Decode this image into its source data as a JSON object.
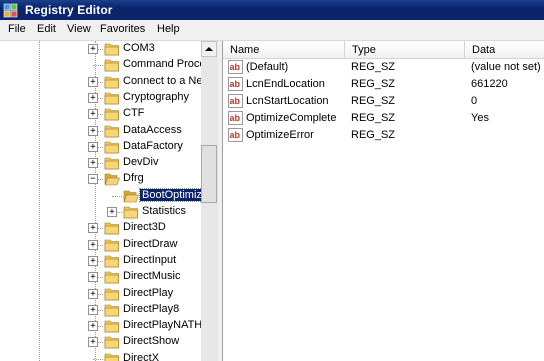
{
  "window": {
    "title": "Registry Editor"
  },
  "menu": [
    "File",
    "Edit",
    "View",
    "Favorites",
    "Help"
  ],
  "tree": {
    "items": [
      {
        "label": "COM3",
        "expander": "+",
        "level": 0
      },
      {
        "label": "Command Proce",
        "expander": "",
        "level": 0
      },
      {
        "label": "Connect to a Ne",
        "expander": "+",
        "level": 0
      },
      {
        "label": "Cryptography",
        "expander": "+",
        "level": 0
      },
      {
        "label": "CTF",
        "expander": "+",
        "level": 0
      },
      {
        "label": "DataAccess",
        "expander": "+",
        "level": 0
      },
      {
        "label": "DataFactory",
        "expander": "+",
        "level": 0
      },
      {
        "label": "DevDiv",
        "expander": "+",
        "level": 0
      },
      {
        "label": "Dfrg",
        "expander": "−",
        "level": 0
      },
      {
        "label": "BootOptimiz",
        "expander": "",
        "level": 1,
        "selected": true
      },
      {
        "label": "Statistics",
        "expander": "+",
        "level": 1
      },
      {
        "label": "Direct3D",
        "expander": "+",
        "level": 0
      },
      {
        "label": "DirectDraw",
        "expander": "+",
        "level": 0
      },
      {
        "label": "DirectInput",
        "expander": "+",
        "level": 0
      },
      {
        "label": "DirectMusic",
        "expander": "+",
        "level": 0
      },
      {
        "label": "DirectPlay",
        "expander": "+",
        "level": 0
      },
      {
        "label": "DirectPlay8",
        "expander": "+",
        "level": 0
      },
      {
        "label": "DirectPlayNATHe",
        "expander": "+",
        "level": 0
      },
      {
        "label": "DirectShow",
        "expander": "+",
        "level": 0
      },
      {
        "label": "DirectX",
        "expander": "",
        "level": 0
      }
    ]
  },
  "list": {
    "columns": [
      "Name",
      "Type",
      "Data"
    ],
    "rows": [
      {
        "name": "(Default)",
        "type": "REG_SZ",
        "data": "(value not set)"
      },
      {
        "name": "LcnEndLocation",
        "type": "REG_SZ",
        "data": "661220"
      },
      {
        "name": "LcnStartLocation",
        "type": "REG_SZ",
        "data": "0"
      },
      {
        "name": "OptimizeComplete",
        "type": "REG_SZ",
        "data": "Yes"
      },
      {
        "name": "OptimizeError",
        "type": "REG_SZ",
        "data": ""
      }
    ],
    "value_icon_text": "ab"
  },
  "colors": {
    "titlebar": "#0a246a",
    "selection": "#0a246a",
    "folder": "#e8c15a",
    "value_icon": "#c0392b"
  }
}
